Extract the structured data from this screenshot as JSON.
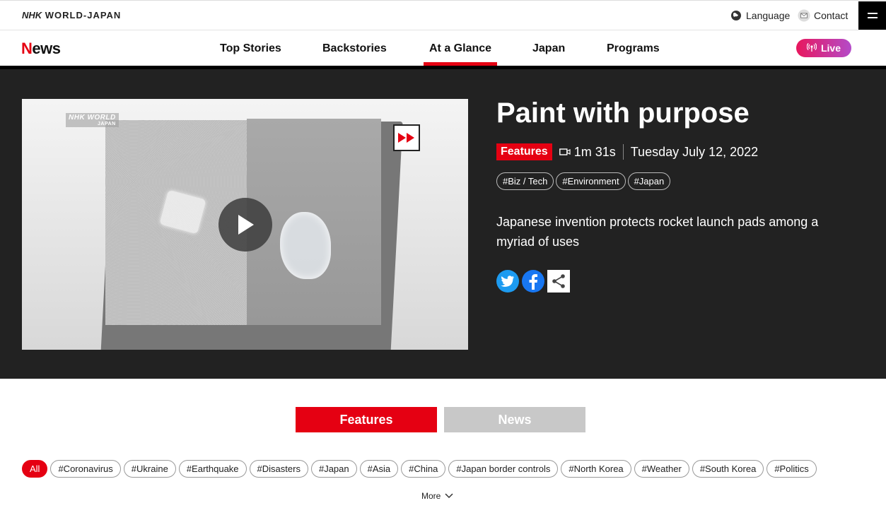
{
  "topbar": {
    "brand_nhk": "NHK",
    "brand_rest": " WORLD-JAPAN",
    "language_label": "Language",
    "contact_label": "Contact",
    "menu_icon": "hamburger-icon"
  },
  "nav": {
    "logo_n": "N",
    "logo_rest": "ews",
    "items": [
      {
        "label": "Top Stories"
      },
      {
        "label": "Backstories"
      },
      {
        "label": "At a Glance",
        "active": true
      },
      {
        "label": "Japan"
      },
      {
        "label": "Programs"
      }
    ],
    "live_label": "Live",
    "accent": "#e50012"
  },
  "hero": {
    "video_watermark": "NHK WORLD",
    "video_watermark_sub": "JAPAN",
    "title": "Paint with purpose",
    "category": "Features",
    "duration": "1m 31s",
    "date": "Tuesday July 12, 2022",
    "tags": [
      "#Biz / Tech",
      "#Environment",
      "#Japan"
    ],
    "description": "Japanese invention protects rocket launch pads among a myriad of uses",
    "social": [
      "twitter-icon",
      "facebook-icon",
      "share-icon"
    ]
  },
  "tabs": {
    "features_label": "Features",
    "news_label": "News"
  },
  "filters": {
    "items": [
      "All",
      "#Coronavirus",
      "#Ukraine",
      "#Earthquake",
      "#Disasters",
      "#Japan",
      "#Asia",
      "#China",
      "#Japan border controls",
      "#North Korea",
      "#Weather",
      "#South Korea",
      "#Politics"
    ],
    "more_label": "More"
  }
}
